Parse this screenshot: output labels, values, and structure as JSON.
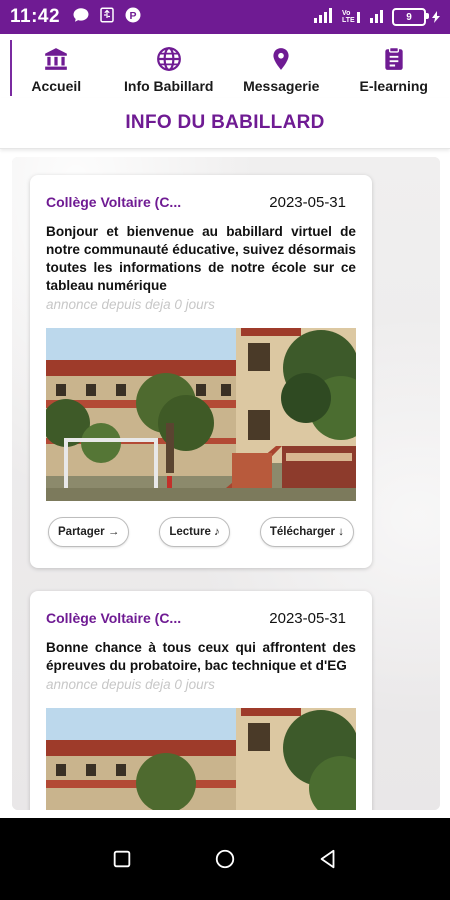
{
  "status_bar": {
    "time": "11:42",
    "left_icons": [
      "message-icon",
      "usb-icon",
      "p-app-icon"
    ],
    "right_icons": [
      "signal-icon",
      "wifi-calling-icon",
      "signal-icon"
    ],
    "battery": "9"
  },
  "nav": {
    "items": [
      {
        "label": "Accueil",
        "icon": "bank-icon"
      },
      {
        "label": "Info Babillard",
        "icon": "globe-icon"
      },
      {
        "label": "Messagerie",
        "icon": "location-pin-icon"
      },
      {
        "label": "E-learning",
        "icon": "clipboard-icon"
      }
    ]
  },
  "page": {
    "title": "INFO DU BABILLARD"
  },
  "posts": [
    {
      "org": "Collège Voltaire (C...",
      "date": "2023-05-31",
      "text": "Bonjour et bienvenue au babillard virtuel de notre communauté éducative, suivez désormais toutes les informations de notre école sur ce tableau numérique",
      "meta": "annonce depuis deja 0 jours",
      "buttons": {
        "share": "Partager →",
        "read": "Lecture ♪",
        "download": "Télécharger ↓"
      }
    },
    {
      "org": "Collège Voltaire (C...",
      "date": "2023-05-31",
      "text": "Bonne chance à tous ceux qui affrontent des épreuves du probatoire, bac technique et d'EG",
      "meta": "annonce depuis deja 0 jours"
    }
  ],
  "system_nav": {
    "icons": [
      "recents-square-icon",
      "home-circle-icon",
      "back-triangle-icon"
    ]
  },
  "colors": {
    "primary": "#6f1b93",
    "status_bar": "#6f1b93",
    "meta_text": "#c7c7c7"
  }
}
